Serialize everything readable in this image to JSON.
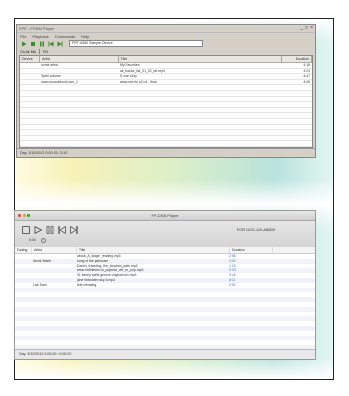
{
  "windows_app": {
    "title": "FPP - FFMM Player",
    "menu": [
      "File",
      "Playback",
      "Commands",
      "Help"
    ],
    "device": "FPP-A080 Sample Device",
    "toolbar2": [
      "On Air Mix",
      "Fill"
    ],
    "columns": [
      "Device",
      "Artist",
      "Title",
      "Duration"
    ],
    "rows": [
      {
        "device": "",
        "artist": "some artist",
        "title": "My Favorites",
        "duration": "4:16"
      },
      {
        "device": "",
        "artist": "",
        "title": "all_tracks_list_01_02_bb.mp3",
        "duration": "3:24"
      },
      {
        "device": "",
        "artist": "Spell volume",
        "title": "S one s1sy",
        "duration": "4:47"
      },
      {
        "device": "",
        "artist": "www.soundcloud.com_1",
        "title": "www.mix.fm s2 n4 - final",
        "duration": "4:45"
      },
      {
        "device": "",
        "artist": "",
        "title": "",
        "duration": ""
      },
      {
        "device": "",
        "artist": "",
        "title": "",
        "duration": ""
      },
      {
        "device": "",
        "artist": "",
        "title": "",
        "duration": ""
      },
      {
        "device": "",
        "artist": "",
        "title": "",
        "duration": ""
      },
      {
        "device": "",
        "artist": "",
        "title": "",
        "duration": ""
      },
      {
        "device": "",
        "artist": "",
        "title": "",
        "duration": ""
      },
      {
        "device": "",
        "artist": "",
        "title": "",
        "duration": ""
      },
      {
        "device": "",
        "artist": "",
        "title": "",
        "duration": ""
      },
      {
        "device": "",
        "artist": "",
        "title": "",
        "duration": ""
      },
      {
        "device": "",
        "artist": "",
        "title": "",
        "duration": ""
      },
      {
        "device": "",
        "artist": "",
        "title": "",
        "duration": ""
      },
      {
        "device": "",
        "artist": "",
        "title": "",
        "duration": ""
      }
    ],
    "status": "Day: 3/10/2012   0:00:15 / 3:10"
  },
  "mac_app": {
    "title": "FP-DSB Player",
    "device": "FOR DOC-US-A8800",
    "time": "0:00",
    "columns": [
      "Fading",
      "Artist",
      "Title",
      "Duration"
    ],
    "rows": [
      {
        "fading": "",
        "artist": "",
        "title": "about_A_stage_reading.mp3",
        "duration": "2:56"
      },
      {
        "fading": "",
        "artist": "Annie Marie",
        "title": "song of the jailhouse",
        "duration": "3:22"
      },
      {
        "fading": "",
        "artist": "",
        "title": "Daniel_traveling_the_blocked_path.mp3",
        "duration": "1:18"
      },
      {
        "fading": "",
        "artist": "",
        "title": "www.mdhtimes.ru_popular_ver_m_pop.mp3",
        "duration": "2:33"
      },
      {
        "fading": "",
        "artist": "",
        "title": "01 benny spills groove original mix.mp3",
        "duration": "3:42"
      },
      {
        "fading": "",
        "artist": "",
        "title": "jane forbidden sky-5.mp3",
        "duration": "8:11"
      },
      {
        "fading": "",
        "artist": "Lab Sam",
        "title": "tele vibrating",
        "duration": "2:52"
      },
      {
        "fading": "",
        "artist": "",
        "title": "",
        "duration": ""
      },
      {
        "fading": "",
        "artist": "",
        "title": "",
        "duration": ""
      },
      {
        "fading": "",
        "artist": "",
        "title": "",
        "duration": ""
      },
      {
        "fading": "",
        "artist": "",
        "title": "",
        "duration": ""
      },
      {
        "fading": "",
        "artist": "",
        "title": "",
        "duration": ""
      },
      {
        "fading": "",
        "artist": "",
        "title": "",
        "duration": ""
      },
      {
        "fading": "",
        "artist": "",
        "title": "",
        "duration": ""
      },
      {
        "fading": "",
        "artist": "",
        "title": "",
        "duration": ""
      },
      {
        "fading": "",
        "artist": "",
        "title": "",
        "duration": ""
      },
      {
        "fading": "",
        "artist": "",
        "title": "",
        "duration": ""
      },
      {
        "fading": "",
        "artist": "",
        "title": "",
        "duration": ""
      },
      {
        "fading": "",
        "artist": "",
        "title": "",
        "duration": ""
      },
      {
        "fading": "",
        "artist": "",
        "title": "",
        "duration": ""
      }
    ],
    "status": "Day: 3/10/2012   0:00:00 / 0:00:22"
  },
  "colors": {
    "accent": "#3a8f2a",
    "mac_close": "#e0443e",
    "mac_min": "#dea123",
    "mac_max": "#1aab29"
  }
}
